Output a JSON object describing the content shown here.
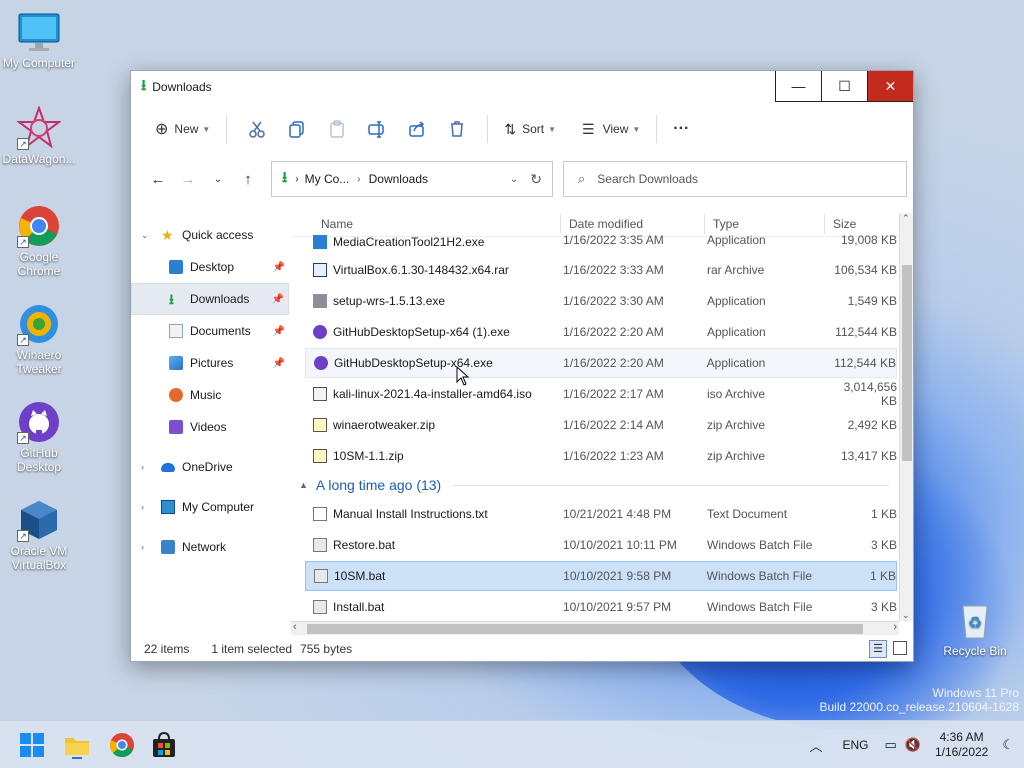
{
  "window": {
    "title": "Downloads",
    "controls": {
      "minimize": "—",
      "maximize": "☐",
      "close": "✕"
    }
  },
  "toolbar": {
    "new_label": "New",
    "sort_label": "Sort",
    "view_label": "View",
    "more_label": "···"
  },
  "address": {
    "crumbs": [
      "My Co...",
      "Downloads"
    ],
    "search_placeholder": "Search Downloads"
  },
  "sidebar": {
    "items": [
      {
        "label": "Quick access"
      },
      {
        "label": "Desktop"
      },
      {
        "label": "Downloads"
      },
      {
        "label": "Documents"
      },
      {
        "label": "Pictures"
      },
      {
        "label": "Music"
      },
      {
        "label": "Videos"
      },
      {
        "label": "OneDrive"
      },
      {
        "label": "My Computer"
      },
      {
        "label": "Network"
      }
    ]
  },
  "columns": {
    "name": "Name",
    "date": "Date modified",
    "type": "Type",
    "size": "Size"
  },
  "files": [
    {
      "name": "MediaCreationTool21H2.exe",
      "date": "1/16/2022 3:35 AM",
      "type": "Application",
      "size": "19,008 KB"
    },
    {
      "name": "VirtualBox.6.1.30-148432.x64.rar",
      "date": "1/16/2022 3:33 AM",
      "type": "rar Archive",
      "size": "106,534 KB"
    },
    {
      "name": "setup-wrs-1.5.13.exe",
      "date": "1/16/2022 3:30 AM",
      "type": "Application",
      "size": "1,549 KB"
    },
    {
      "name": "GitHubDesktopSetup-x64 (1).exe",
      "date": "1/16/2022 2:20 AM",
      "type": "Application",
      "size": "112,544 KB"
    },
    {
      "name": "GitHubDesktopSetup-x64.exe",
      "date": "1/16/2022 2:20 AM",
      "type": "Application",
      "size": "112,544 KB"
    },
    {
      "name": "kali-linux-2021.4a-installer-amd64.iso",
      "date": "1/16/2022 2:17 AM",
      "type": "iso Archive",
      "size": "3,014,656 KB"
    },
    {
      "name": "winaerotweaker.zip",
      "date": "1/16/2022 2:14 AM",
      "type": "zip Archive",
      "size": "2,492 KB"
    },
    {
      "name": "10SM-1.1.zip",
      "date": "1/16/2022 1:23 AM",
      "type": "zip Archive",
      "size": "13,417 KB"
    }
  ],
  "group2": {
    "title": "A long time ago (13)"
  },
  "files2": [
    {
      "name": "Manual Install Instructions.txt",
      "date": "10/21/2021 4:48 PM",
      "type": "Text Document",
      "size": "1 KB"
    },
    {
      "name": "Restore.bat",
      "date": "10/10/2021 10:11 PM",
      "type": "Windows Batch File",
      "size": "3 KB"
    },
    {
      "name": "10SM.bat",
      "date": "10/10/2021 9:58 PM",
      "type": "Windows Batch File",
      "size": "1 KB"
    },
    {
      "name": "Install.bat",
      "date": "10/10/2021 9:57 PM",
      "type": "Windows Batch File",
      "size": "3 KB"
    }
  ],
  "status": {
    "count": "22 items",
    "selected": "1 item selected",
    "bytes": "755 bytes"
  },
  "desktop": {
    "icons": [
      {
        "label": "My Computer"
      },
      {
        "label": "DataWagon..."
      },
      {
        "label": "Google Chrome"
      },
      {
        "label": "Winaero Tweaker"
      },
      {
        "label": "GitHub Desktop"
      },
      {
        "label": "Oracle VM VirtualBox"
      },
      {
        "label": "Recycle Bin"
      }
    ],
    "watermark_line1": "Windows 11 Pro",
    "watermark_line2": "Build 22000.co_release.210604-1628"
  },
  "tray": {
    "lang": "ENG",
    "time": "4:36 AM",
    "date": "1/16/2022"
  },
  "colors": {
    "accent": "#0067c0",
    "close_red": "#c42b1c",
    "selection": "#cce0f7"
  }
}
